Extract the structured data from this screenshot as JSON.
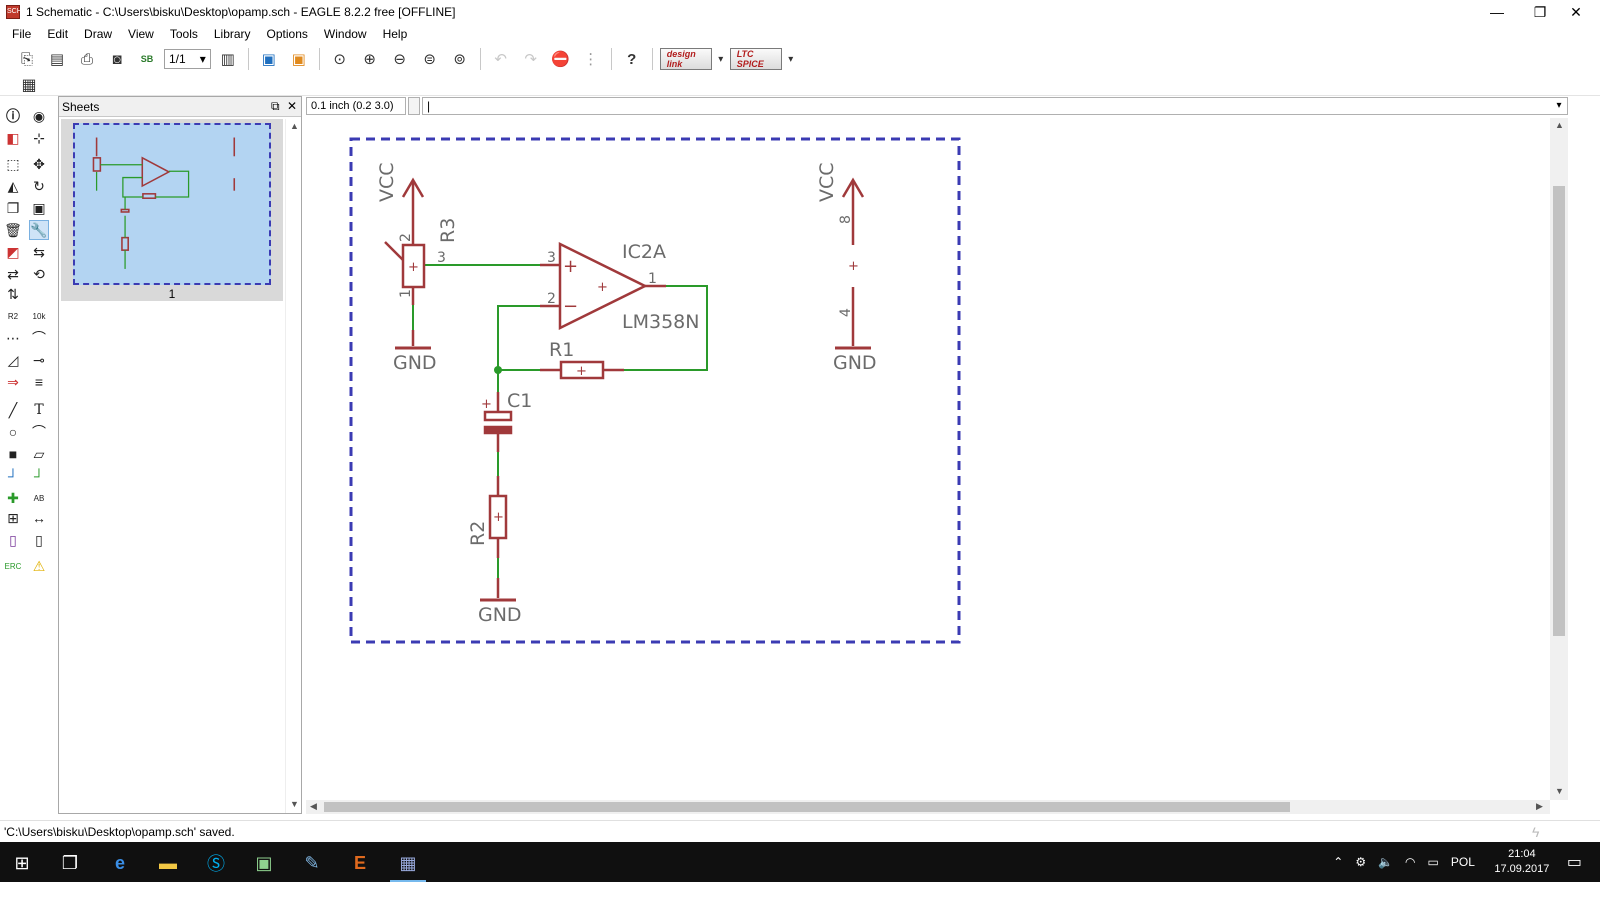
{
  "window": {
    "title": "1 Schematic - C:\\Users\\bisku\\Desktop\\opamp.sch - EAGLE 8.2.2 free [OFFLINE]",
    "app_icon_text": "SCH",
    "controls": {
      "minimize": "—",
      "maximize": "❐",
      "close": "✕"
    }
  },
  "menu": [
    "File",
    "Edit",
    "Draw",
    "View",
    "Tools",
    "Library",
    "Options",
    "Window",
    "Help"
  ],
  "toolbar": {
    "sheet_select": "1/1",
    "design_link_label": "design link",
    "ltspice_label": "LTC SPICE"
  },
  "sheets_panel": {
    "title": "Sheets",
    "sheet_number": "1"
  },
  "command": {
    "coordinate": "0.1 inch (0.2 3.0)",
    "input_value": "|"
  },
  "schematic": {
    "vcc_left": "VCC",
    "vcc_right": "VCC",
    "gnd_top_left": "GND",
    "gnd_right": "GND",
    "gnd_bottom": "GND",
    "r3": "R3",
    "r3_pin1": "1",
    "r3_pin2": "2",
    "r3_pin3": "3",
    "ic_name": "IC2A",
    "ic_value": "LM358N",
    "ic_pin1": "1",
    "ic_pin2": "2",
    "ic_pin3": "3",
    "ic_pin4": "4",
    "ic_pin8": "8",
    "r1": "R1",
    "c1": "C1",
    "r2": "R2",
    "plus": "+",
    "minus": "−"
  },
  "status": {
    "message": "'C:\\Users\\bisku\\Desktop\\opamp.sch' saved."
  },
  "taskbar": {
    "language": "POL",
    "time": "21:04",
    "date": "17.09.2017"
  },
  "colors": {
    "net": "#2a9a2a",
    "symbol": "#a0393b",
    "frame": "#3b3bb3",
    "label_gray": "#6b6b6b"
  }
}
